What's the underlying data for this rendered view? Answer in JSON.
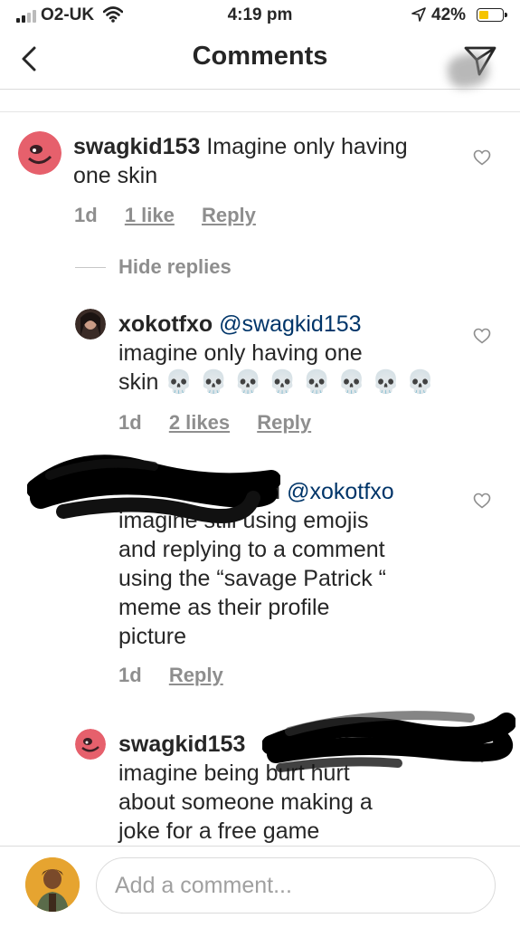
{
  "status_bar": {
    "carrier": "O2-UK",
    "time": "4:19 pm",
    "battery_pct": "42%",
    "battery_level": 0.42
  },
  "nav": {
    "title": "Comments",
    "back_icon": "chevron-left-icon",
    "send_icon": "paper-plane-icon"
  },
  "comments": [
    {
      "user": "swagkid153",
      "text": "Imagine only having one skin",
      "time": "1d",
      "likes": "1 like",
      "reply": "Reply"
    }
  ],
  "replies_toggle": "Hide replies",
  "replies": [
    {
      "user": "xokotfxo",
      "mention": "@swagkid153",
      "text_line1": "imagine only having one",
      "text_line2": "skin",
      "emoji": "💀💀💀💀💀💀💀💀",
      "time": "1d",
      "likes": "2 likes",
      "reply": "Reply"
    },
    {
      "user_visible": "oi",
      "mention": "@xokotfxo",
      "text_lines": [
        "imagine still using emojis",
        "and replying to a comment",
        "using the “savage Patrick “",
        "meme as their profile",
        "picture"
      ],
      "time": "1d",
      "reply": "Reply"
    },
    {
      "user": "swagkid153",
      "text_lines": [
        "imagine being burt hurt",
        "about someone making a",
        "joke for a free game"
      ]
    }
  ],
  "composer": {
    "placeholder": "Add a comment..."
  },
  "colors": {
    "text": "#262626",
    "muted": "#8e8e8e",
    "mention": "#003569",
    "border": "#dbdbdb",
    "battery": "#f5c400"
  }
}
